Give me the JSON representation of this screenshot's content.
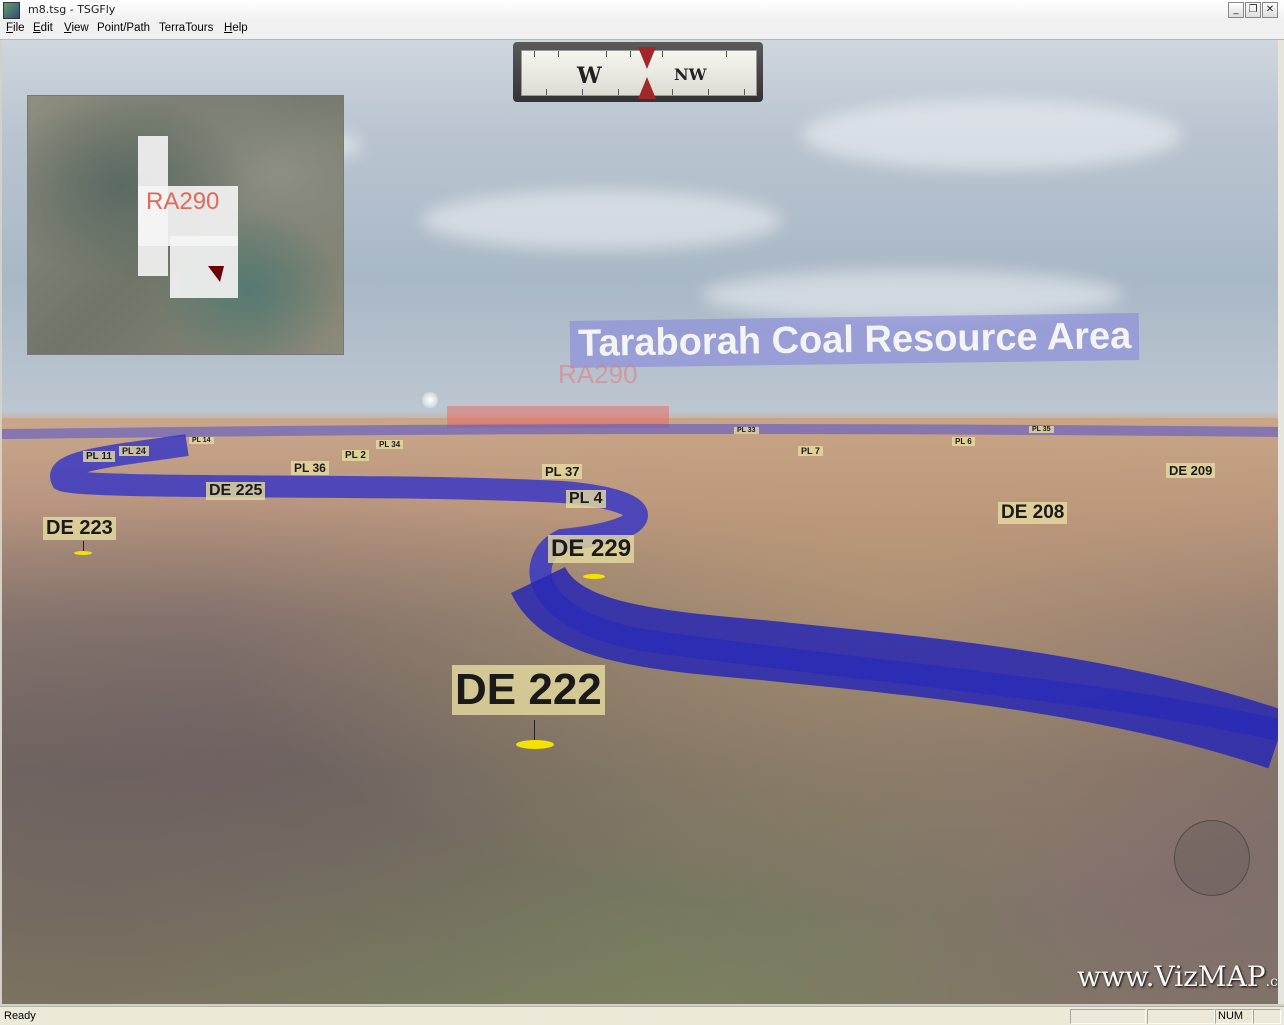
{
  "window": {
    "title": "m8.tsg - TSGFly",
    "minimize": "0",
    "restore": "1",
    "close": "r"
  },
  "menu": [
    {
      "key": "F",
      "rest": "ile"
    },
    {
      "key": "E",
      "rest": "dit"
    },
    {
      "key": "V",
      "rest": "iew"
    },
    {
      "key": "",
      "rest": "Point/Path"
    },
    {
      "key": "",
      "rest": "TerraTours"
    },
    {
      "key": "H",
      "rest": "elp"
    }
  ],
  "compass": {
    "left_heading": "W",
    "right_heading": "NW"
  },
  "inset_map": {
    "label": "RA290"
  },
  "overlay": {
    "area_title": "Taraborah Coal Resource Area",
    "region_label": "RA290"
  },
  "waypoints": {
    "de222": "DE 222",
    "de223": "DE 223",
    "de225": "DE 225",
    "de229": "DE 229",
    "de208": "DE 208",
    "de209": "DE 209",
    "pl4": "PL 4",
    "pl37": "PL 37",
    "pl36": "PL 36",
    "pl2": "PL 2",
    "pl11": "PL 11",
    "pl24": "PL 24",
    "pl14": "PL 14",
    "pl34": "PL 34",
    "pl7": "PL 7",
    "pl6": "PL 6",
    "pl35": "PL 35",
    "pl33": "PL 33"
  },
  "watermark": {
    "main": "www.VizMAP",
    "suffix": ".com.au"
  },
  "status": {
    "text": "Ready",
    "num": "NUM"
  },
  "colors": {
    "path": "#3a3ad0",
    "label_bg": "#e6dca0",
    "marker": "#f6e200",
    "area_label_bg": "#8c8cdc"
  }
}
